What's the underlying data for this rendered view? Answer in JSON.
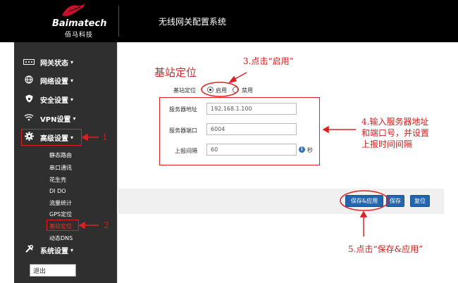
{
  "header": {
    "brand": "Baimatech",
    "brand_sub": "佰马科技",
    "system_title": "无线网关配置系统"
  },
  "sidebar": {
    "nav": [
      {
        "label": "网关状态",
        "icon": "network-status-icon"
      },
      {
        "label": "网络设置",
        "icon": "network-globe-icon"
      },
      {
        "label": "安全设置",
        "icon": "shield-icon"
      },
      {
        "label": "VPN设置",
        "icon": "wifi-icon"
      },
      {
        "label": "高级设置",
        "icon": "gear-icon"
      },
      {
        "label": "系统设置",
        "icon": "tools-icon"
      }
    ],
    "caret": "▾",
    "sub_items": [
      "静态路由",
      "串口通讯",
      "花生壳",
      "DI DO",
      "流量统计",
      "GPS定位",
      "基站定位",
      "动态DNS"
    ],
    "logout": "退出"
  },
  "form": {
    "heading": "基站定位",
    "mode_label": "基站定位",
    "enable": "启用",
    "disable": "禁用",
    "server_addr_label": "服务器地址",
    "server_addr_value": "192.168.1.100",
    "server_port_label": "服务器端口",
    "server_port_value": "6004",
    "interval_label": "上报间隔",
    "interval_value": "60",
    "interval_unit": "秒"
  },
  "buttons": {
    "save_apply": "保存&应用",
    "save": "保存",
    "reset": "复位"
  },
  "annotations": {
    "step1": "1",
    "step2": "2",
    "step3": "3.点击“启用”",
    "step4_line1": "4.输入服务器地址",
    "step4_line2": "和端口号，并设置",
    "step4_line3": "上报时间间隔",
    "step5": "5.点击“保存&应用”"
  },
  "colors": {
    "annotation_red": "#d02020",
    "button_blue": "#2265b0",
    "sidebar_bg": "#2f2f2f"
  }
}
